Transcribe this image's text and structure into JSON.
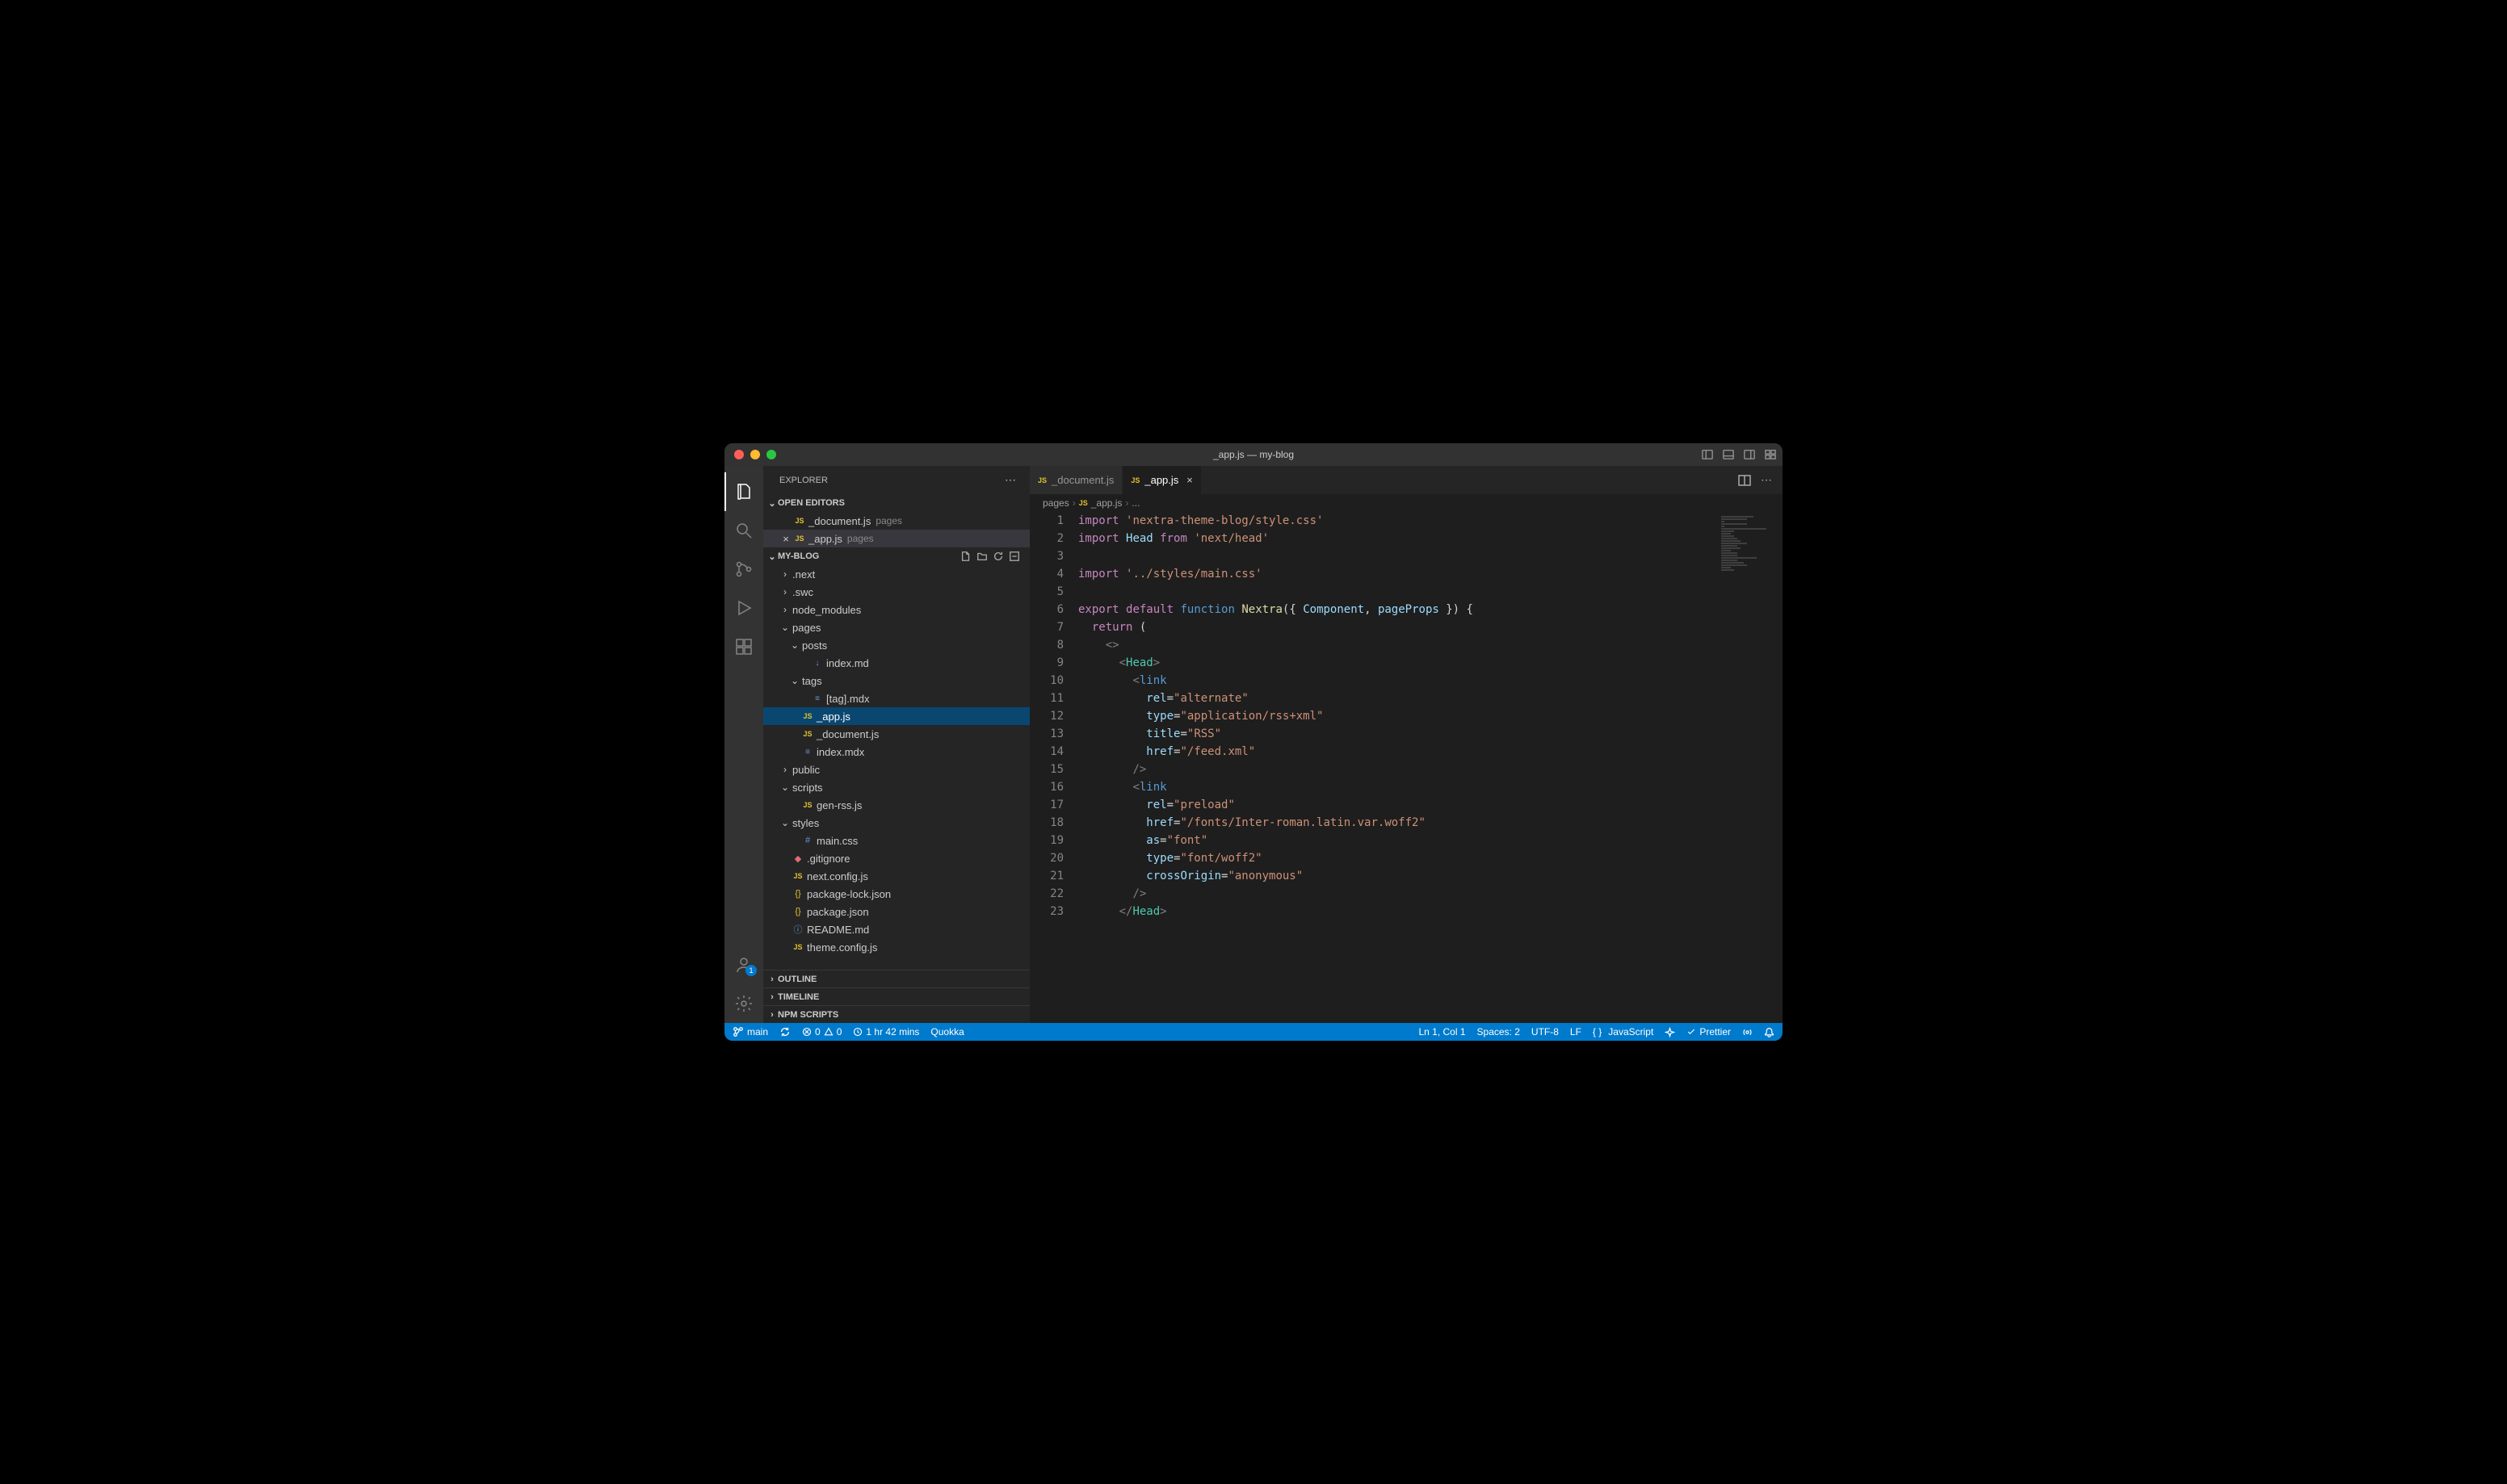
{
  "window": {
    "title": "_app.js — my-blog"
  },
  "sidebar": {
    "title": "EXPLORER",
    "sections": {
      "open_editors": {
        "label": "OPEN EDITORS",
        "items": [
          {
            "name": "_document.js",
            "desc": "pages",
            "icon": "js"
          },
          {
            "name": "_app.js",
            "desc": "pages",
            "icon": "js",
            "active": true
          }
        ]
      },
      "project": {
        "label": "MY-BLOG",
        "tree": [
          {
            "name": ".next",
            "type": "folder",
            "indent": 1,
            "open": false
          },
          {
            "name": ".swc",
            "type": "folder",
            "indent": 1,
            "open": false
          },
          {
            "name": "node_modules",
            "type": "folder",
            "indent": 1,
            "open": false
          },
          {
            "name": "pages",
            "type": "folder",
            "indent": 1,
            "open": true
          },
          {
            "name": "posts",
            "type": "folder",
            "indent": 2,
            "open": true
          },
          {
            "name": "index.md",
            "type": "file",
            "indent": 3,
            "icon": "md"
          },
          {
            "name": "tags",
            "type": "folder",
            "indent": 2,
            "open": true
          },
          {
            "name": "[tag].mdx",
            "type": "file",
            "indent": 3,
            "icon": "mdx"
          },
          {
            "name": "_app.js",
            "type": "file",
            "indent": 2,
            "icon": "js",
            "selected": true
          },
          {
            "name": "_document.js",
            "type": "file",
            "indent": 2,
            "icon": "js"
          },
          {
            "name": "index.mdx",
            "type": "file",
            "indent": 2,
            "icon": "mdx"
          },
          {
            "name": "public",
            "type": "folder",
            "indent": 1,
            "open": false
          },
          {
            "name": "scripts",
            "type": "folder",
            "indent": 1,
            "open": true
          },
          {
            "name": "gen-rss.js",
            "type": "file",
            "indent": 2,
            "icon": "js"
          },
          {
            "name": "styles",
            "type": "folder",
            "indent": 1,
            "open": true
          },
          {
            "name": "main.css",
            "type": "file",
            "indent": 2,
            "icon": "css"
          },
          {
            "name": ".gitignore",
            "type": "file",
            "indent": 1,
            "icon": "git"
          },
          {
            "name": "next.config.js",
            "type": "file",
            "indent": 1,
            "icon": "js"
          },
          {
            "name": "package-lock.json",
            "type": "file",
            "indent": 1,
            "icon": "json"
          },
          {
            "name": "package.json",
            "type": "file",
            "indent": 1,
            "icon": "json"
          },
          {
            "name": "README.md",
            "type": "file",
            "indent": 1,
            "icon": "info"
          },
          {
            "name": "theme.config.js",
            "type": "file",
            "indent": 1,
            "icon": "js"
          }
        ]
      },
      "outline": {
        "label": "OUTLINE"
      },
      "timeline": {
        "label": "TIMELINE"
      },
      "npm_scripts": {
        "label": "NPM SCRIPTS"
      }
    }
  },
  "tabs": [
    {
      "name": "_document.js",
      "active": false
    },
    {
      "name": "_app.js",
      "active": true
    }
  ],
  "breadcrumb": {
    "seg1": "pages",
    "seg2": "_app.js",
    "seg3": "..."
  },
  "code": {
    "lines": 23,
    "tokens": {
      "l1_kw": "import",
      "l1_str": "'nextra-theme-blog/style.css'",
      "l2_kw": "import",
      "l2_id": "Head",
      "l2_from": "from",
      "l2_str": "'next/head'",
      "l4_kw": "import",
      "l4_str": "'../styles/main.css'",
      "l6_export": "export",
      "l6_default": "default",
      "l6_function": "function",
      "l6_name": "Nextra",
      "l6_comp": "Component",
      "l6_pp": "pageProps",
      "l7_ret": "return",
      "l9_head": "Head",
      "l10_link": "link",
      "l11_rel": "rel",
      "l11_val": "\"alternate\"",
      "l12_type": "type",
      "l12_val": "\"application/rss+xml\"",
      "l13_title": "title",
      "l13_val": "\"RSS\"",
      "l14_href": "href",
      "l14_val": "\"/feed.xml\"",
      "l16_link": "link",
      "l17_rel": "rel",
      "l17_val": "\"preload\"",
      "l18_href": "href",
      "l18_val": "\"/fonts/Inter-roman.latin.var.woff2\"",
      "l19_as": "as",
      "l19_val": "\"font\"",
      "l20_type": "type",
      "l20_val": "\"font/woff2\"",
      "l21_co": "crossOrigin",
      "l21_val": "\"anonymous\"",
      "l23_head": "Head"
    }
  },
  "status": {
    "branch": "main",
    "errors": "0",
    "warnings": "0",
    "time": "1 hr 42 mins",
    "quokka": "Quokka",
    "cursor": "Ln 1, Col 1",
    "spaces": "Spaces: 2",
    "encoding": "UTF-8",
    "eol": "LF",
    "language": "JavaScript",
    "prettier": "Prettier"
  },
  "accounts_badge": "1"
}
